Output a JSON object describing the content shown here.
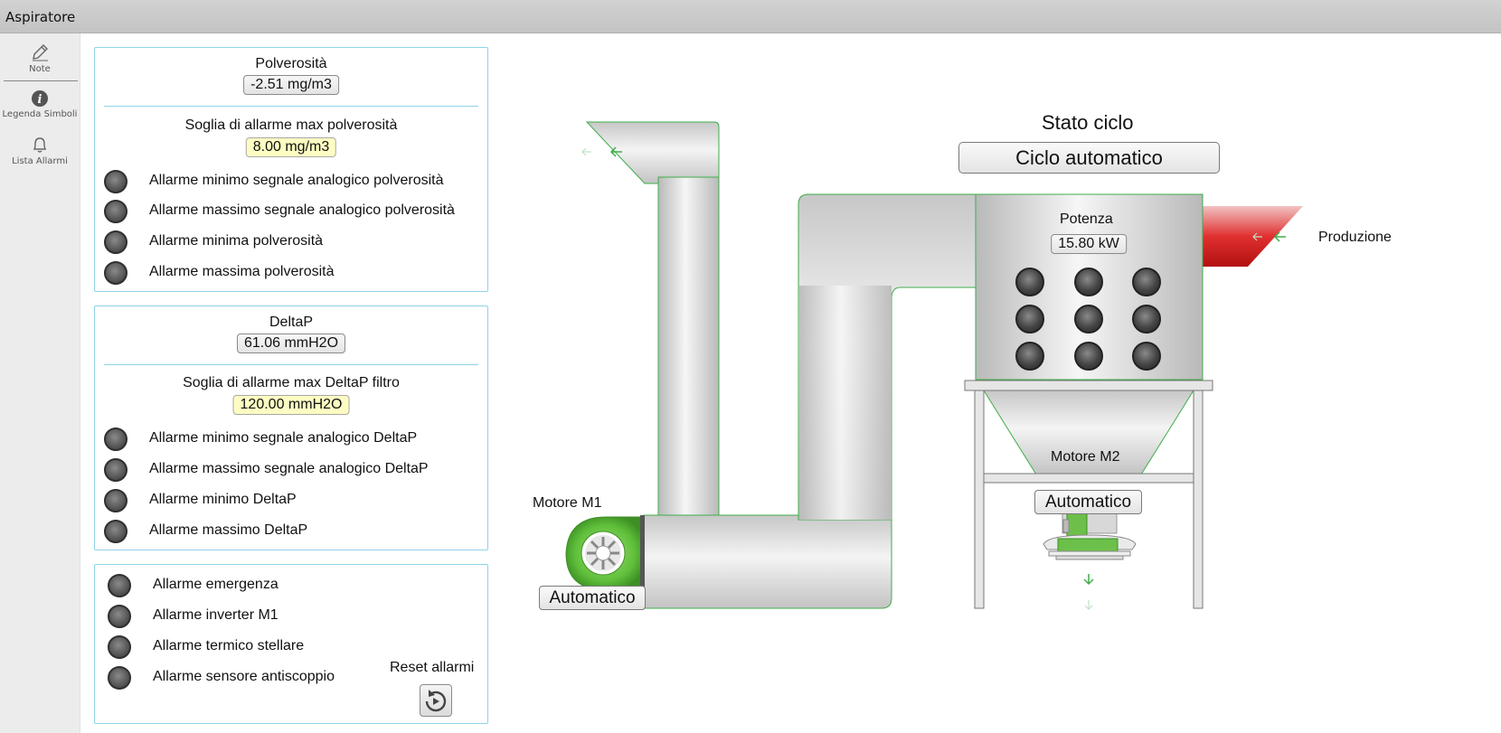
{
  "window": {
    "title": "Aspiratore"
  },
  "sidebar": {
    "items": [
      {
        "label": "Note",
        "icon": "pencil-icon"
      },
      {
        "label": "Legenda Simboli",
        "icon": "info-icon"
      },
      {
        "label": "Lista Allarmi",
        "icon": "bell-icon"
      }
    ]
  },
  "dust_panel": {
    "title": "Polverosità",
    "value": "-2.51 mg/m3",
    "threshold_label": "Soglia di allarme max polverosità",
    "threshold_value": "8.00 mg/m3",
    "alarms": [
      "Allarme minimo segnale analogico polverosità",
      "Allarme massimo segnale analogico polverosità",
      "Allarme minima polverosità",
      "Allarme massima polverosità"
    ]
  },
  "deltap_panel": {
    "title": "DeltaP",
    "value": "61.06 mmH2O",
    "threshold_label": "Soglia di allarme max DeltaP filtro",
    "threshold_value": "120.00 mmH2O",
    "alarms": [
      "Allarme minimo segnale analogico DeltaP",
      "Allarme massimo segnale analogico DeltaP",
      "Allarme minimo DeltaP",
      "Allarme massimo DeltaP"
    ]
  },
  "general_alarms": {
    "alarms": [
      "Allarme emergenza",
      "Allarme inverter M1",
      "Allarme termico stellare",
      "Allarme sensore antiscoppio"
    ],
    "reset_label": "Reset allarmi"
  },
  "process": {
    "cycle_state_label": "Stato ciclo",
    "cycle_state_value": "Ciclo automatico",
    "power_label": "Potenza",
    "power_value": "15.80 kW",
    "production_label": "Produzione",
    "motor1_label": "Motore M1",
    "motor1_mode": "Automatico",
    "motor2_label": "Motore M2",
    "motor2_mode": "Automatico"
  },
  "colors": {
    "pipe_outline": "#3fae49",
    "panel_border": "#8fd2ea",
    "alarm_off": "#4d4d4d",
    "threshold_bg": "#fdfcc2",
    "production_red": "#d01c1c",
    "fan_green": "#5fbf3a"
  }
}
